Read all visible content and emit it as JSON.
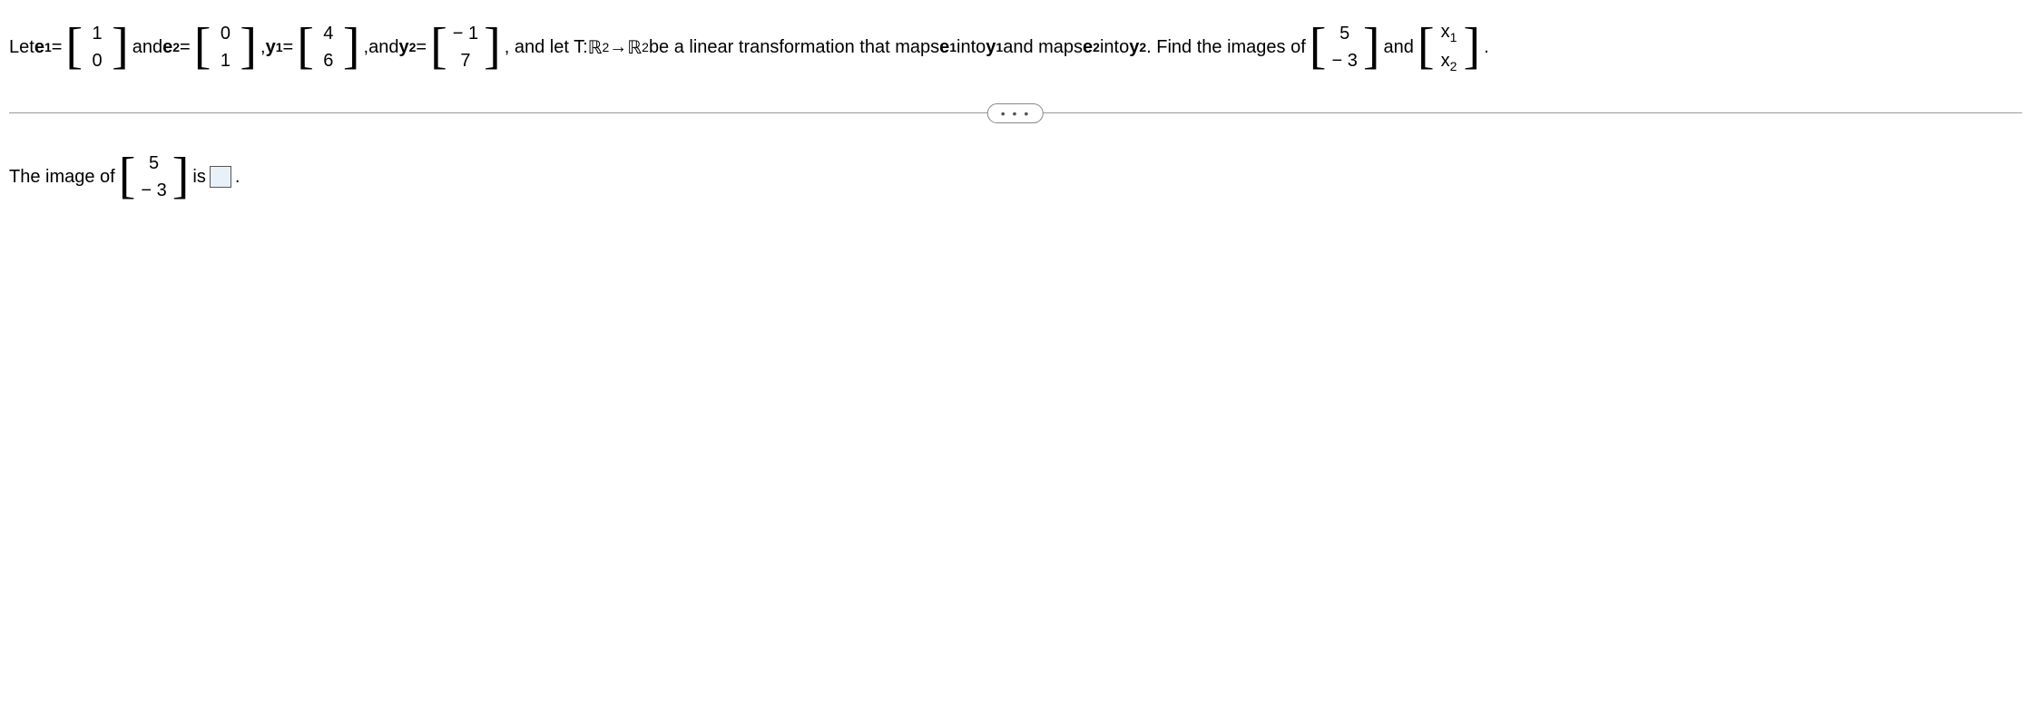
{
  "problem": {
    "let": "Let ",
    "e1_label": "e",
    "e1_sub": "1",
    "eq": " = ",
    "e1_vec": [
      "1",
      "0"
    ],
    "and": " and ",
    "e2_label": "e",
    "e2_sub": "2",
    "e2_vec": [
      "0",
      "1"
    ],
    "comma": ", ",
    "y1_label": "y",
    "y1_sub": "1",
    "y1_vec": [
      "4",
      "6"
    ],
    "y2_label": "y",
    "y2_sub": "2",
    "y2_vec": [
      "− 1",
      "7"
    ],
    "transform_text1": ", and let T: ",
    "R": "ℝ",
    "pow2_a": "2",
    "arrow": "→",
    "pow2_b": "2",
    "transform_text2": " be a linear transformation that maps ",
    "into": " into ",
    "and_maps": " and maps ",
    "find_text": ". Find the images of ",
    "vec5": [
      "5",
      "− 3"
    ],
    "and2": " and ",
    "vecx": [
      "x",
      "x"
    ],
    "x1_sub": "1",
    "x2_sub": "2",
    "period": "."
  },
  "divider": {
    "ellipsis": "• • •"
  },
  "answer": {
    "prefix": "The image of ",
    "vec": [
      "5",
      "− 3"
    ],
    "is": " is ",
    "period": "."
  }
}
